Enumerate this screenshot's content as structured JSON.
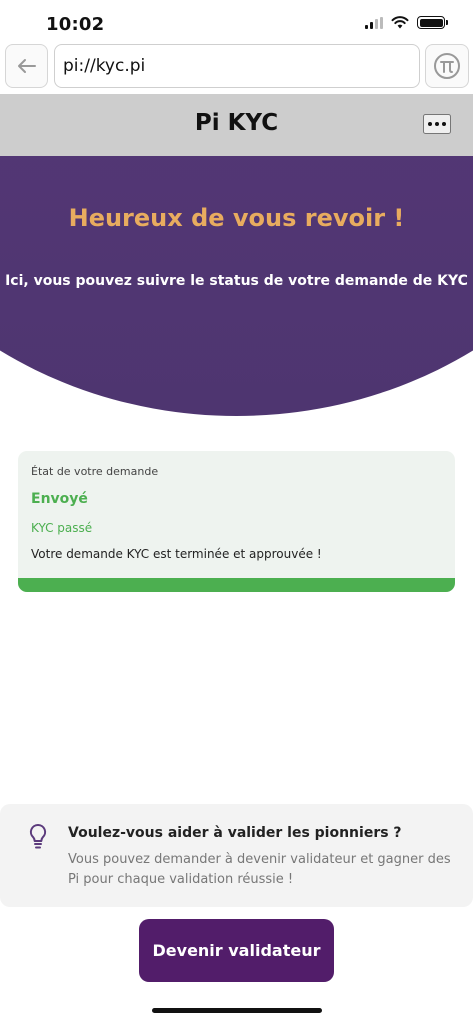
{
  "status_bar": {
    "time": "10:02"
  },
  "browser": {
    "url": "pi://kyc.pi",
    "back_icon": "arrow-left-icon",
    "pi_icon": "pi-logo-icon"
  },
  "header": {
    "title": "Pi KYC",
    "menu_icon": "more-horizontal-icon"
  },
  "hero": {
    "title": "Heureux de vous revoir !",
    "subtitle": "Ici, vous pouvez suivre le status de votre demande de KYC"
  },
  "status_card": {
    "label": "État de votre demande",
    "state": "Envoyé",
    "kyc_status": "KYC passé",
    "message": "Votre demande KYC est terminée et approuvée !"
  },
  "info_card": {
    "icon": "lightbulb-icon",
    "title": "Voulez-vous aider à valider les pionniers ?",
    "text": "Vous pouvez demander à devenir validateur et gagner des Pi pour chaque validation réussie !"
  },
  "cta": {
    "label": "Devenir validateur"
  },
  "colors": {
    "purple": "#5b3a7c",
    "accent_orange": "#e8ac5f",
    "success_green": "#4caf50",
    "button_purple": "#521d6a"
  }
}
